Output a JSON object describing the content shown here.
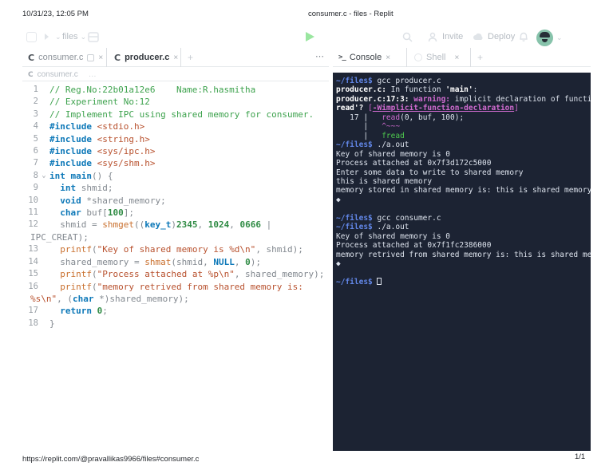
{
  "print_header": {
    "timestamp": "10/31/23, 12:05 PM",
    "document_title": "consumer.c - files - Replit"
  },
  "print_footer": {
    "url": "https://replit.com/@pravallikas9966/files#consumer.c",
    "page_indicator": "1/1"
  },
  "toolbar": {
    "files_menu": "files",
    "invite": "Invite",
    "deploy": "Deploy"
  },
  "editor_tabs": {
    "tab1": "consumer.c",
    "tab2": "producer.c",
    "new_tab": "+",
    "overflow": "⋯",
    "close": "×"
  },
  "console_tabs": {
    "tab1": "Console",
    "tab2": "Shell",
    "new_tab": "+",
    "close": "×",
    "terminal_icon": ">_"
  },
  "breadcrumb": {
    "file_icon": "C",
    "file": "consumer.c",
    "more": "…"
  },
  "language_icon": "C",
  "fold_arrow": "⌄",
  "colors": {
    "run_button_green": "#9ae6a0",
    "avatar_teal": "#87c3ab",
    "console_background": "#1c2333",
    "prompt_blue": "#6287e8",
    "warning_magenta": "#d06bd0",
    "suggestion_green": "#4ec94e",
    "comment_green": "#3da24d",
    "keyword_blue": "#0d78b8",
    "string_orange": "#b8512e",
    "number_green": "#2f8b44"
  },
  "code": {
    "rows": [
      {
        "n": "1",
        "seg": [
          {
            "t": "// Reg.No:22b01a12e6    Name:R.hasmitha",
            "c": "cm"
          }
        ]
      },
      {
        "n": "2",
        "seg": [
          {
            "t": "// Experiment No:12",
            "c": "cm"
          }
        ]
      },
      {
        "n": "3",
        "seg": [
          {
            "t": "// Implement IPC using shared memory for consumer.",
            "c": "cm"
          }
        ]
      },
      {
        "n": "4",
        "seg": [
          {
            "t": "#include",
            "c": "kw"
          },
          {
            "t": " "
          },
          {
            "t": "<stdio.h>",
            "c": "str"
          }
        ]
      },
      {
        "n": "5",
        "seg": [
          {
            "t": "#include",
            "c": "kw"
          },
          {
            "t": " "
          },
          {
            "t": "<string.h>",
            "c": "str"
          }
        ]
      },
      {
        "n": "6",
        "seg": [
          {
            "t": "#include",
            "c": "kw"
          },
          {
            "t": " "
          },
          {
            "t": "<sys/ipc.h>",
            "c": "str"
          }
        ]
      },
      {
        "n": "7",
        "seg": [
          {
            "t": "#include",
            "c": "kw"
          },
          {
            "t": " "
          },
          {
            "t": "<sys/shm.h>",
            "c": "str"
          }
        ]
      },
      {
        "n": "8",
        "fold": true,
        "seg": [
          {
            "t": "int",
            "c": "kw"
          },
          {
            "t": " "
          },
          {
            "t": "main",
            "c": "kw"
          },
          {
            "t": "() {"
          }
        ]
      },
      {
        "n": "9",
        "seg": [
          {
            "t": "  "
          },
          {
            "t": "int",
            "c": "kw"
          },
          {
            "t": " shmid;"
          }
        ]
      },
      {
        "n": "10",
        "seg": [
          {
            "t": "  "
          },
          {
            "t": "void",
            "c": "kw"
          },
          {
            "t": " *shared_memory;"
          }
        ]
      },
      {
        "n": "11",
        "seg": [
          {
            "t": "  "
          },
          {
            "t": "char",
            "c": "kw"
          },
          {
            "t": " buf["
          },
          {
            "t": "100",
            "c": "num"
          },
          {
            "t": "];"
          }
        ]
      },
      {
        "n": "12",
        "seg": [
          {
            "t": "  shmid = "
          },
          {
            "t": "shmget",
            "c": "fn"
          },
          {
            "t": "(("
          },
          {
            "t": "key_t",
            "c": "kw"
          },
          {
            "t": ")"
          },
          {
            "t": "2345",
            "c": "num"
          },
          {
            "t": ", "
          },
          {
            "t": "1024",
            "c": "num"
          },
          {
            "t": ", "
          },
          {
            "t": "0666",
            "c": "num"
          },
          {
            "t": " |"
          }
        ]
      },
      {
        "wrap": true,
        "seg": [
          {
            "t": "IPC_CREAT);"
          }
        ]
      },
      {
        "n": "13",
        "seg": [
          {
            "t": "  "
          },
          {
            "t": "printf",
            "c": "fn"
          },
          {
            "t": "("
          },
          {
            "t": "\"Key of shared memory is %d\\n\"",
            "c": "str"
          },
          {
            "t": ", shmid);"
          }
        ]
      },
      {
        "n": "14",
        "seg": [
          {
            "t": "  shared_memory = "
          },
          {
            "t": "shmat",
            "c": "fn"
          },
          {
            "t": "(shmid, "
          },
          {
            "t": "NULL",
            "c": "kw"
          },
          {
            "t": ", "
          },
          {
            "t": "0",
            "c": "num"
          },
          {
            "t": ");"
          }
        ]
      },
      {
        "n": "15",
        "seg": [
          {
            "t": "  "
          },
          {
            "t": "printf",
            "c": "fn"
          },
          {
            "t": "("
          },
          {
            "t": "\"Process attached at %p\\n\"",
            "c": "str"
          },
          {
            "t": ", shared_memory);"
          }
        ]
      },
      {
        "n": "16",
        "seg": [
          {
            "t": "  "
          },
          {
            "t": "printf",
            "c": "fn"
          },
          {
            "t": "("
          },
          {
            "t": "\"memory retrived from shared memory is:",
            "c": "str"
          }
        ]
      },
      {
        "wrap": true,
        "seg": [
          {
            "t": "%s\\n\"",
            "c": "str"
          },
          {
            "t": ", ("
          },
          {
            "t": "char",
            "c": "kw"
          },
          {
            "t": " *)shared_memory);"
          }
        ]
      },
      {
        "n": "17",
        "seg": [
          {
            "t": "  "
          },
          {
            "t": "return",
            "c": "kw"
          },
          {
            "t": " "
          },
          {
            "t": "0",
            "c": "num"
          },
          {
            "t": ";"
          }
        ]
      },
      {
        "n": "18",
        "seg": [
          {
            "t": "}"
          }
        ]
      }
    ]
  },
  "console": {
    "rows": [
      [
        {
          "t": "~/files$ ",
          "c": "p"
        },
        {
          "t": "gcc producer.c"
        }
      ],
      [
        {
          "t": "producer.c:",
          "c": "b"
        },
        {
          "t": " In function "
        },
        {
          "t": "'main'",
          "c": "b"
        },
        {
          "t": ":"
        }
      ],
      [
        {
          "t": "producer.c:17:3:",
          "c": "b"
        },
        {
          "t": " "
        },
        {
          "t": "warning:",
          "c": "w"
        },
        {
          "t": " implicit declaration of functi"
        }
      ],
      [
        {
          "t": "read'?",
          "c": "b"
        },
        {
          "t": " "
        },
        {
          "t": "[",
          "c": "m"
        },
        {
          "t": "-Wimplicit-function-declaration",
          "c": "u"
        },
        {
          "t": "]",
          "c": "m"
        }
      ],
      [
        {
          "t": "   17 |   "
        },
        {
          "t": "read",
          "c": "m"
        },
        {
          "t": "(0, buf, 100);"
        }
      ],
      [
        {
          "t": "      |   "
        },
        {
          "t": "^~~~",
          "c": "m"
        }
      ],
      [
        {
          "t": "      |   "
        },
        {
          "t": "fread",
          "c": "g"
        }
      ],
      [
        {
          "t": "~/files$ ",
          "c": "p"
        },
        {
          "t": "./a.out"
        }
      ],
      [
        {
          "t": "Key of shared memory is 0"
        }
      ],
      [
        {
          "t": "Process attached at 0x7f3d172c5000"
        }
      ],
      [
        {
          "t": "Enter some data to write to shared memory"
        }
      ],
      [
        {
          "t": "this is shared memory"
        }
      ],
      [
        {
          "t": "memory stored in shared memory is: this is shared memory"
        }
      ],
      [
        {
          "t": "◆"
        }
      ],
      [],
      [
        {
          "t": "~/files$ ",
          "c": "p"
        },
        {
          "t": "gcc consumer.c"
        }
      ],
      [
        {
          "t": "~/files$ ",
          "c": "p"
        },
        {
          "t": "./a.out"
        }
      ],
      [
        {
          "t": "Key of shared memory is 0"
        }
      ],
      [
        {
          "t": "Process attached at 0x7f1fc2386000"
        }
      ],
      [
        {
          "t": "memory retrived from shared memory is: this is shared me"
        }
      ],
      [
        {
          "t": "◆"
        }
      ],
      [],
      [
        {
          "t": "~/files$ ",
          "c": "p"
        },
        {
          "t": "",
          "c": "cur"
        }
      ]
    ]
  }
}
